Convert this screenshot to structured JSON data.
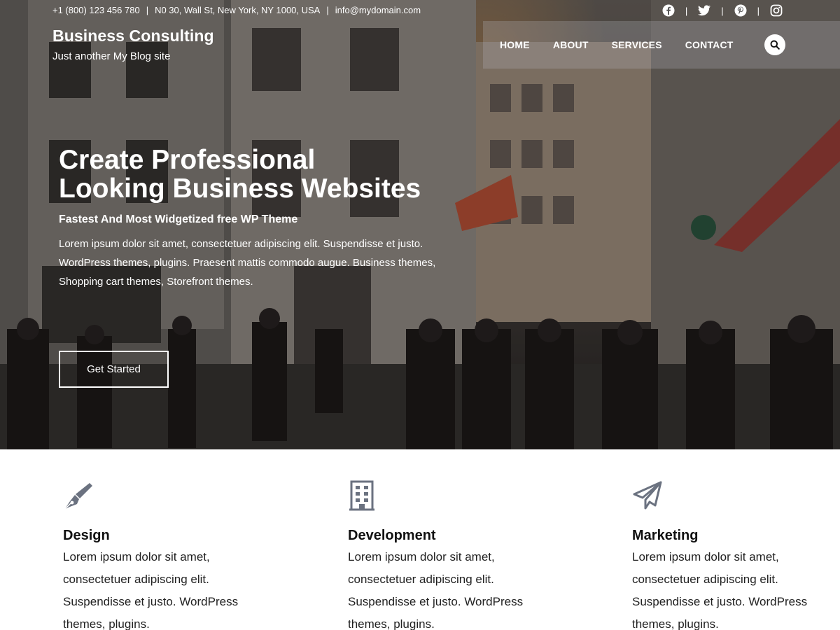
{
  "topbar": {
    "phone": "+1 (800) 123 456 780",
    "address": "N0 30, Wall St, New York, NY 1000, USA",
    "email": "info@mydomain.com",
    "separator": "|",
    "social_icons": [
      "facebook-icon",
      "twitter-icon",
      "pinterest-icon",
      "instagram-icon"
    ]
  },
  "brand": {
    "title": "Business Consulting",
    "tagline": "Just another My Blog site"
  },
  "nav": {
    "items": [
      "HOME",
      "ABOUT",
      "SERVICES",
      "CONTACT"
    ],
    "search_icon": "search-icon"
  },
  "hero": {
    "title_line1": "Create Professional",
    "title_line2": "Looking Business Websites",
    "subtitle": "Fastest And Most Widgetized free WP Theme",
    "text": "Lorem ipsum dolor sit amet, consectetuer adipiscing elit. Suspendisse et justo. WordPress themes, plugins. Praesent mattis commodo augue. Business themes, Shopping cart themes, Storefront themes.",
    "cta_label": "Get Started"
  },
  "features": [
    {
      "icon": "pen-icon",
      "title": "Design",
      "text": "Lorem ipsum dolor sit amet, consectetuer adipiscing elit. Suspendisse et justo. WordPress themes, plugins."
    },
    {
      "icon": "building-icon",
      "title": "Development",
      "text": "Lorem ipsum dolor sit amet, consectetuer adipiscing elit. Suspendisse et justo. WordPress themes, plugins."
    },
    {
      "icon": "paper-plane-icon",
      "title": "Marketing",
      "text": "Lorem ipsum dolor sit amet, consectetuer adipiscing elit. Suspendisse et justo. WordPress themes, plugins."
    }
  ],
  "colors": {
    "icon_gray": "#6b7280",
    "overlay": "#000000",
    "text_white": "#ffffff"
  }
}
